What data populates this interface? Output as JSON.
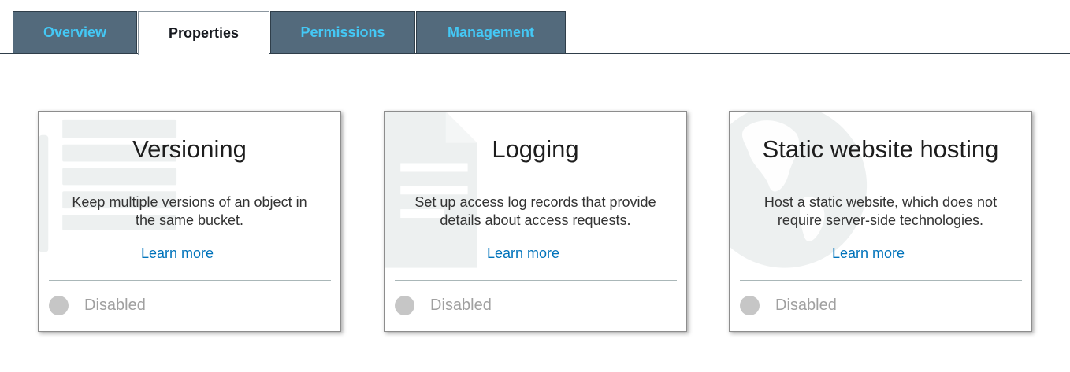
{
  "tabs": [
    {
      "label": "Overview",
      "active": false
    },
    {
      "label": "Properties",
      "active": true
    },
    {
      "label": "Permissions",
      "active": false
    },
    {
      "label": "Management",
      "active": false
    }
  ],
  "cards": [
    {
      "title": "Versioning",
      "description": "Keep multiple versions of an object in the same bucket.",
      "link": "Learn more",
      "status": "Disabled",
      "watermark_icon": "document-list-icon"
    },
    {
      "title": "Logging",
      "description": "Set up access log records that provide details about access requests.",
      "link": "Learn more",
      "status": "Disabled",
      "watermark_icon": "log-file-icon"
    },
    {
      "title": "Static website hosting",
      "description": "Host a static website, which does not require server-side technologies.",
      "link": "Learn more",
      "status": "Disabled",
      "watermark_icon": "globe-icon"
    }
  ],
  "colors": {
    "tab_background": "#536a7c",
    "tab_text": "#44c8f5",
    "link": "#0073bb",
    "status_disabled": "#c6c6c6"
  }
}
